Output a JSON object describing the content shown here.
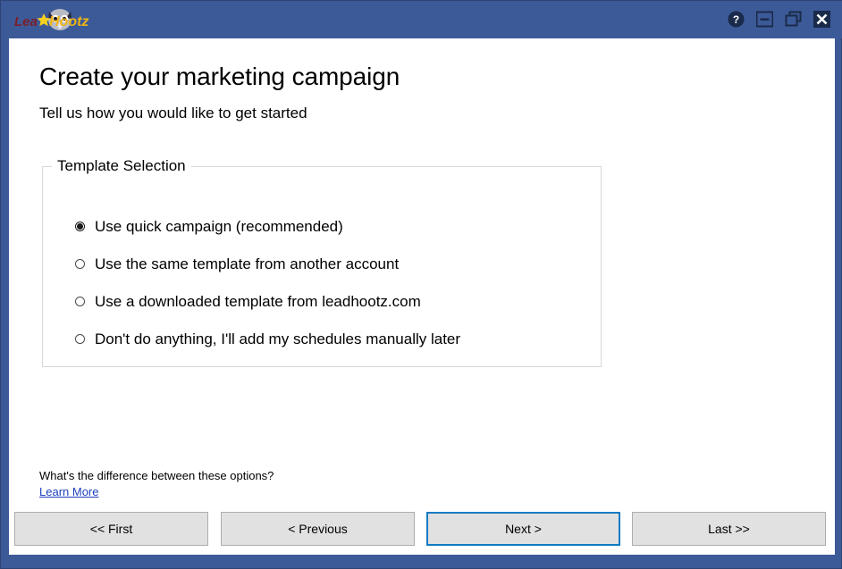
{
  "window": {
    "frame_color": "#3c5a98",
    "client_background": "#ffffff"
  },
  "titlebar": {
    "logo": {
      "name": "leadhootz-logo",
      "text_primary": "Lead",
      "text_secondary": "Hootz",
      "primary_color": "#7a1f2b",
      "secondary_color": "#f0b416",
      "star_color": "#f5d020",
      "owl_color": "#b9bcc4"
    },
    "controls": [
      {
        "name": "help-icon",
        "label": "Help",
        "glyph": "?"
      },
      {
        "name": "minimize-icon",
        "label": "Minimize",
        "glyph": "–"
      },
      {
        "name": "restore-icon",
        "label": "Restore",
        "glyph": "❐"
      },
      {
        "name": "close-icon",
        "label": "Close",
        "glyph": "✕"
      }
    ]
  },
  "page": {
    "title": "Create your marketing campaign",
    "subtitle": "Tell us how you would like to get started"
  },
  "group": {
    "legend": "Template Selection",
    "options": [
      {
        "label": "Use quick campaign (recommended)",
        "checked": true
      },
      {
        "label": "Use the same template from another account",
        "checked": false
      },
      {
        "label": "Use a downloaded template from leadhootz.com",
        "checked": false
      },
      {
        "label": "Don't do anything, I'll add my schedules manually later",
        "checked": false
      }
    ]
  },
  "help": {
    "question": "What's the difference between these options?",
    "link_label": "Learn More",
    "link_color": "#1f3fbe"
  },
  "navigation": {
    "focus_color": "#0f7bc4",
    "buttons": [
      {
        "label": "<< First",
        "focused": false
      },
      {
        "label": "< Previous",
        "focused": false
      },
      {
        "label": "Next >",
        "focused": true
      },
      {
        "label": "Last >>",
        "focused": false
      }
    ]
  }
}
